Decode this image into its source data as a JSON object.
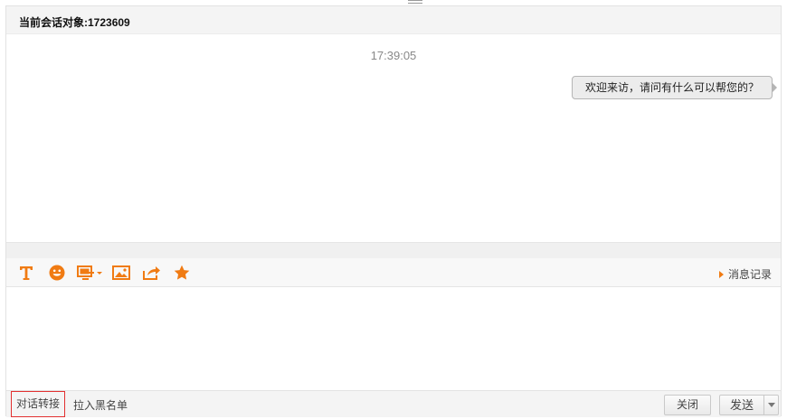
{
  "header": {
    "title": "当前会话对象:1723609"
  },
  "messages": {
    "timestamp": "17:39:05",
    "items": [
      {
        "side": "right",
        "text": "欢迎来访，请问有什么可以帮您的？"
      }
    ]
  },
  "toolbar": {
    "icons": [
      "font-icon",
      "emoji-icon",
      "screenshot-icon",
      "image-icon",
      "share-icon",
      "star-icon"
    ],
    "history_label": "消息记录",
    "accent_color": "#f07b13"
  },
  "input": {
    "value": "",
    "placeholder": ""
  },
  "footer": {
    "transfer_label": "对话转接",
    "blacklist_label": "拉入黑名单",
    "close_label": "关闭",
    "send_label": "发送"
  }
}
